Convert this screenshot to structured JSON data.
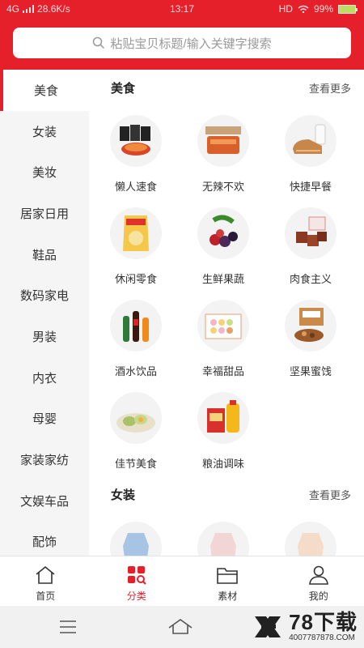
{
  "status": {
    "network": "4G",
    "speed": "28.6K/s",
    "time": "13:17",
    "hd": "HD",
    "battery": "99%",
    "battery_level": 0.99
  },
  "search": {
    "placeholder": "粘贴宝贝标题/输入关键字搜索",
    "icon": "search-icon"
  },
  "sidebar": {
    "items": [
      {
        "label": "美食"
      },
      {
        "label": "女装"
      },
      {
        "label": "美妆"
      },
      {
        "label": "居家日用"
      },
      {
        "label": "鞋品"
      },
      {
        "label": "数码家电"
      },
      {
        "label": "男装"
      },
      {
        "label": "内衣"
      },
      {
        "label": "母婴"
      },
      {
        "label": "家装家纺"
      },
      {
        "label": "文娱车品"
      },
      {
        "label": "配饰"
      }
    ],
    "active": "美食"
  },
  "sections": [
    {
      "title": "美食",
      "more": "查看更多",
      "items": [
        {
          "label": "懒人速食"
        },
        {
          "label": "无辣不欢"
        },
        {
          "label": "快捷早餐"
        },
        {
          "label": "休闲零食"
        },
        {
          "label": "生鲜果蔬"
        },
        {
          "label": "肉食主义"
        },
        {
          "label": "酒水饮品"
        },
        {
          "label": "幸福甜品"
        },
        {
          "label": "坚果蜜饯"
        },
        {
          "label": "佳节美食"
        },
        {
          "label": "粮油调味"
        }
      ]
    },
    {
      "title": "女装",
      "more": "查看更多"
    }
  ],
  "tabbar": {
    "items": [
      {
        "label": "首页",
        "icon": "home-icon"
      },
      {
        "label": "分类",
        "icon": "category-icon"
      },
      {
        "label": "素材",
        "icon": "folder-icon"
      },
      {
        "label": "我的",
        "icon": "user-icon"
      }
    ],
    "active": "分类"
  },
  "watermark": {
    "main": "78下载",
    "url": "4007787878.COM"
  },
  "colors": {
    "brand": "#e5202a",
    "sidebar_bg": "#f5f5f5"
  }
}
